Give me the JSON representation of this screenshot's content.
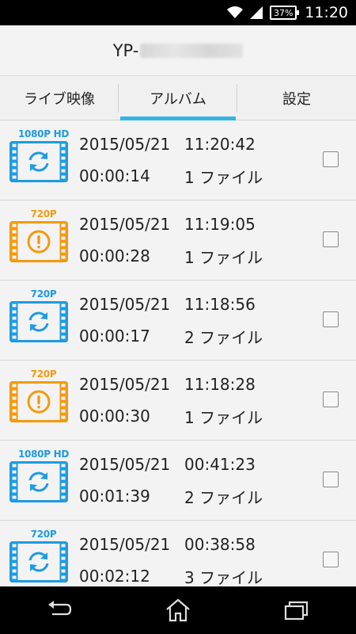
{
  "status": {
    "battery": "37%",
    "time": "11:20"
  },
  "header": {
    "title_prefix": "YP-"
  },
  "tabs": [
    {
      "label": "ライブ映像",
      "active": false
    },
    {
      "label": "アルバム",
      "active": true
    },
    {
      "label": "設定",
      "active": false
    }
  ],
  "colors": {
    "accent": "#33b5e5",
    "ok_blue": "#1e9be0",
    "warn_orange": "#f29b11"
  },
  "videos": [
    {
      "resolution": "1080P HD",
      "status_icon": "sync-icon",
      "date": "2015/05/21",
      "time": "11:20:42",
      "duration": "00:00:14",
      "files": "1 ファイル",
      "checked": false
    },
    {
      "resolution": "720P",
      "status_icon": "warning-icon",
      "date": "2015/05/21",
      "time": "11:19:05",
      "duration": "00:00:28",
      "files": "1 ファイル",
      "checked": false
    },
    {
      "resolution": "720P",
      "status_icon": "sync-icon",
      "date": "2015/05/21",
      "time": "11:18:56",
      "duration": "00:00:17",
      "files": "2 ファイル",
      "checked": false
    },
    {
      "resolution": "720P",
      "status_icon": "warning-icon",
      "date": "2015/05/21",
      "time": "11:18:28",
      "duration": "00:00:30",
      "files": "1 ファイル",
      "checked": false
    },
    {
      "resolution": "1080P HD",
      "status_icon": "sync-icon",
      "date": "2015/05/21",
      "time": "00:41:23",
      "duration": "00:01:39",
      "files": "2 ファイル",
      "checked": false
    },
    {
      "resolution": "720P",
      "status_icon": "sync-icon",
      "date": "2015/05/21",
      "time": "00:38:58",
      "duration": "00:02:12",
      "files": "3 ファイル",
      "checked": false
    }
  ]
}
